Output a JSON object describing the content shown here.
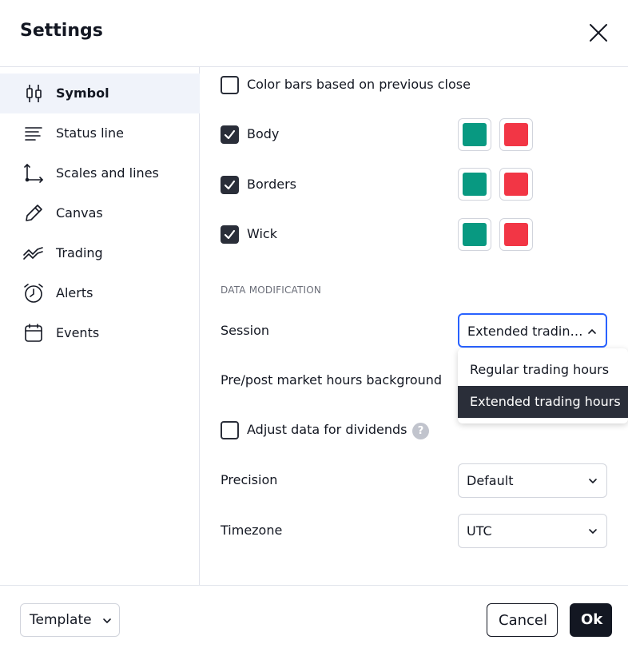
{
  "dialog": {
    "title": "Settings"
  },
  "sidebar": {
    "items": [
      {
        "label": "Symbol",
        "icon": "candlestick-icon",
        "active": true
      },
      {
        "label": "Status line",
        "icon": "status-line-icon",
        "active": false
      },
      {
        "label": "Scales and lines",
        "icon": "scales-icon",
        "active": false
      },
      {
        "label": "Canvas",
        "icon": "pencil-icon",
        "active": false
      },
      {
        "label": "Trading",
        "icon": "trading-icon",
        "active": false
      },
      {
        "label": "Alerts",
        "icon": "alarm-clock-icon",
        "active": false
      },
      {
        "label": "Events",
        "icon": "calendar-icon",
        "active": false
      }
    ]
  },
  "symbol": {
    "color_bars": {
      "label": "Color bars based on previous close",
      "checked": false
    },
    "body": {
      "label": "Body",
      "checked": true,
      "up_color": "#089981",
      "down_color": "#f23645"
    },
    "borders": {
      "label": "Borders",
      "checked": true,
      "up_color": "#089981",
      "down_color": "#f23645"
    },
    "wick": {
      "label": "Wick",
      "checked": true,
      "up_color": "#089981",
      "down_color": "#f23645"
    },
    "data_modification_title": "DATA MODIFICATION",
    "session": {
      "label": "Session",
      "value": "Extended tradin…"
    },
    "session_options": [
      {
        "label": "Regular trading hours",
        "selected": false
      },
      {
        "label": "Extended trading hours",
        "selected": true
      }
    ],
    "pre_post": {
      "label": "Pre/post market hours background"
    },
    "dividends": {
      "label": "Adjust data for dividends",
      "checked": false,
      "help": "?"
    },
    "precision": {
      "label": "Precision",
      "value": "Default"
    },
    "timezone": {
      "label": "Timezone",
      "value": "UTC"
    }
  },
  "footer": {
    "template_label": "Template",
    "cancel_label": "Cancel",
    "ok_label": "Ok"
  },
  "colors": {
    "accent": "#2962ff",
    "dark": "#2a2e39",
    "up": "#089981",
    "down": "#f23645"
  }
}
